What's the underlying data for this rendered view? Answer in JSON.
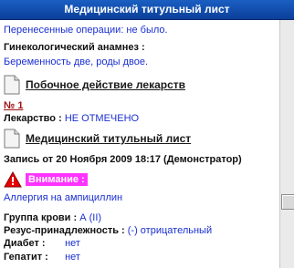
{
  "header": {
    "title": "Медицинский титульный лист"
  },
  "lines": {
    "prev_operations": "Перенесенные операции: не было.",
    "gyn_label": "Гинекологический анамнез :",
    "gyn_value": "Беременность две, роды двое.",
    "drug_label": "Лекарство :",
    "drug_value": "НЕ ОТМЕЧЕНО",
    "record": "Запись от 20 Ноября 2009 18:17 (Демонстратор)",
    "allergy": "Аллергия на ампициллин",
    "blood_label": "Группа крови :",
    "blood_value": "А (II)",
    "rh_label": "Резус-принадлежность :",
    "rh_value": "(-) отрицательный",
    "diabetes_label": "Диабет :",
    "diabetes_value": "нет",
    "hepatitis_label": "Гепатит :",
    "hepatitis_value": "нет"
  },
  "sections": {
    "side_effects": "Побочное действие лекарств",
    "number_link": "№ 1",
    "medical_title": "Медицинский титульный лист"
  },
  "attention": {
    "label": "Внимание :"
  },
  "icons": {
    "document": "document-icon",
    "warning": "warning-icon"
  },
  "colors": {
    "title_bar": "#0b3f9a",
    "value_text": "#1a2fd0",
    "attention_bg": "#ff33ff",
    "link_red": "#a01010"
  }
}
